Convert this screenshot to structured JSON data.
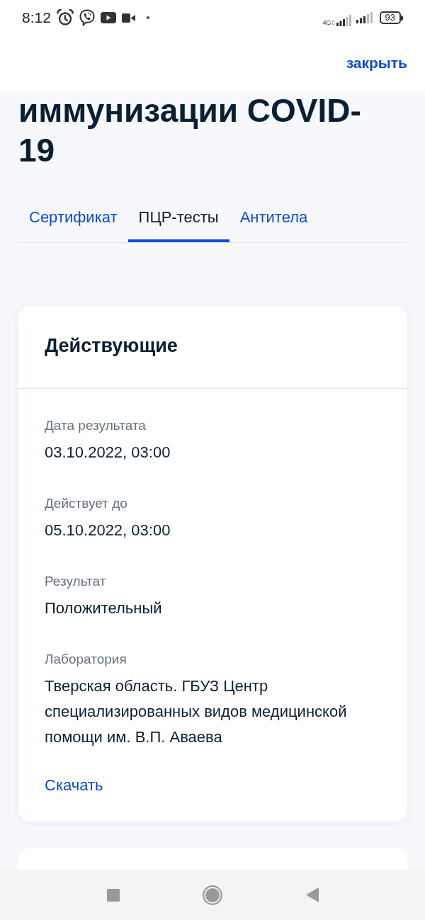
{
  "status_bar": {
    "time": "8:12",
    "network": "4G",
    "battery": "93"
  },
  "header": {
    "close_label": "закрыть"
  },
  "title": "иммунизации COVID-19",
  "tabs": [
    {
      "label": "Сертификат",
      "selected": false
    },
    {
      "label": "ПЦР-тесты",
      "selected": true
    },
    {
      "label": "Антитела",
      "selected": false
    }
  ],
  "cards": [
    {
      "title": "Действующие",
      "fields": [
        {
          "label": "Дата результата",
          "value": "03.10.2022, 03:00"
        },
        {
          "label": "Действует до",
          "value": "05.10.2022, 03:00"
        },
        {
          "label": "Результат",
          "value": "Положительный"
        },
        {
          "label": "Лаборатория",
          "value": "Тверская область. ГБУЗ Центр специализированных видов медицинской помощи им. В.П. Аваева"
        }
      ],
      "link": "Скачать"
    }
  ]
}
